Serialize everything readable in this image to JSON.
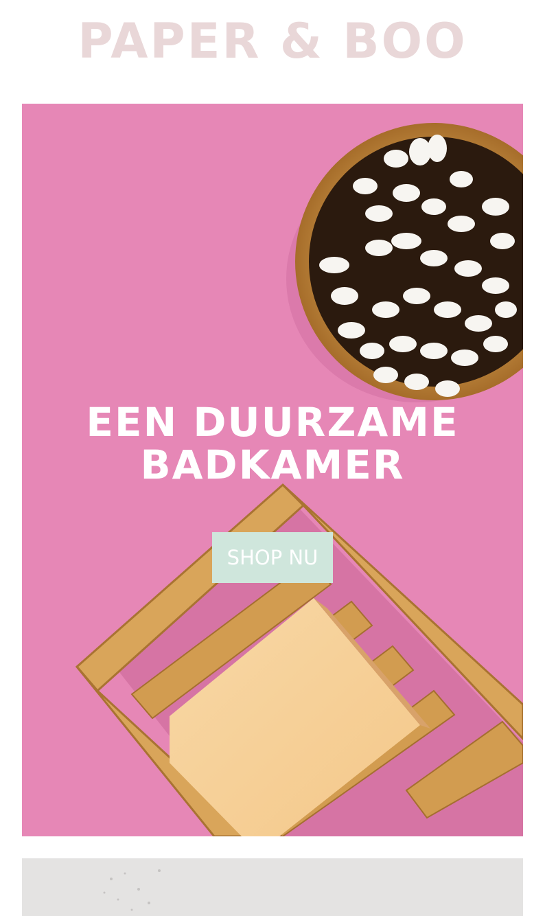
{
  "brand": {
    "logo": "PAPER & BOO"
  },
  "hero": {
    "headline_line1": "EEN DUURZAME",
    "headline_line2": "BADKAMER",
    "button_label": "SHOP NU",
    "background_color": "#e687b6",
    "button_color": "#cfe6dc"
  },
  "images": {
    "hero_image": "cotton-swabs-bowl-and-soap-dish-photo",
    "second_tile": "stone-texture-photo"
  }
}
